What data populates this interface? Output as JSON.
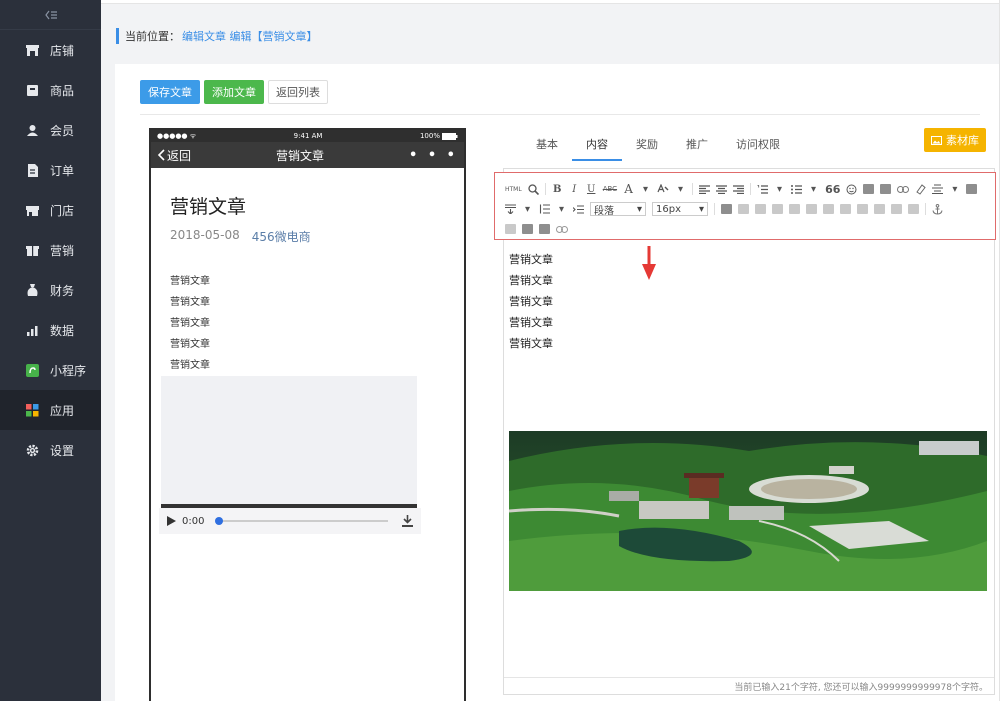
{
  "sidebar": {
    "collapse_icon": "collapse-icon",
    "items": [
      {
        "label": "店铺",
        "icon": "store-icon"
      },
      {
        "label": "商品",
        "icon": "goods-icon"
      },
      {
        "label": "会员",
        "icon": "member-icon"
      },
      {
        "label": "订单",
        "icon": "order-icon"
      },
      {
        "label": "门店",
        "icon": "shop-icon"
      },
      {
        "label": "营销",
        "icon": "marketing-icon"
      },
      {
        "label": "财务",
        "icon": "finance-icon"
      },
      {
        "label": "数据",
        "icon": "data-icon"
      },
      {
        "label": "小程序",
        "icon": "miniprogram-icon"
      },
      {
        "label": "应用",
        "icon": "apps-icon"
      },
      {
        "label": "设置",
        "icon": "settings-icon"
      }
    ],
    "active_label": "应用"
  },
  "breadcrumb": {
    "prefix": "当前位置：",
    "link": "编辑文章 编辑【营销文章】"
  },
  "buttons": {
    "save": "保存文章",
    "add": "添加文章",
    "back": "返回列表"
  },
  "phone": {
    "signal": "●●●●● ᯤ",
    "time": "9:41 AM",
    "battery": "100%",
    "back_label": "返回",
    "nav_title": "营销文章",
    "more": "• • •",
    "article_title": "营销文章",
    "date": "2018-05-08",
    "author": "456微电商",
    "lines": [
      "营销文章",
      "营销文章",
      "营销文章",
      "营销文章",
      "营销文章"
    ],
    "audio_time": "0:00"
  },
  "tabs": [
    "基本",
    "内容",
    "奖励",
    "推广",
    "访问权限"
  ],
  "active_tab": "内容",
  "material_button": "素材库",
  "toolbar": {
    "html": "HTML",
    "bold": "B",
    "italic": "I",
    "underline": "U",
    "strike": "ABC",
    "font_color": "A",
    "quote": "66",
    "paragraph_select": "段落",
    "size_select": "16px"
  },
  "editor": {
    "lines": [
      "营销文章",
      "营销文章",
      "营销文章",
      "营销文章",
      "营销文章"
    ],
    "counter": "当前已输入21个字符, 您还可以输入9999999999978个字符。"
  },
  "colors": {
    "sidebar_bg": "#2b303b",
    "accent": "#3a8ee6",
    "green": "#4cb84c",
    "material": "#f5b400",
    "highlight_border": "#e06b6b"
  }
}
